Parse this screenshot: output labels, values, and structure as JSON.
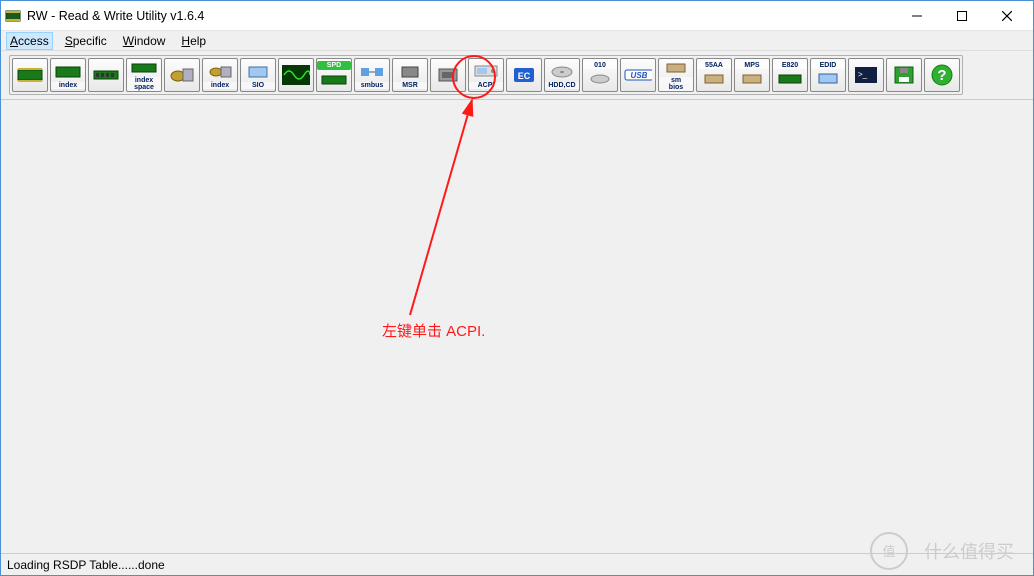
{
  "titlebar": {
    "title": "RW - Read & Write Utility v1.6.4"
  },
  "menubar": {
    "items": [
      {
        "label": "Access",
        "underline": "A",
        "selected": true
      },
      {
        "label": "Specific",
        "underline": "S",
        "selected": false
      },
      {
        "label": "Window",
        "underline": "W",
        "selected": false
      },
      {
        "label": "Help",
        "underline": "H",
        "selected": false
      }
    ]
  },
  "toolbar": {
    "buttons": [
      {
        "name": "pci-button",
        "caption": ""
      },
      {
        "name": "index-button",
        "caption": "index"
      },
      {
        "name": "memory-button",
        "caption": ""
      },
      {
        "name": "index-space-button",
        "caption": "index\nspace"
      },
      {
        "name": "io-button",
        "caption": ""
      },
      {
        "name": "io-index-button",
        "caption": "index"
      },
      {
        "name": "sio-button",
        "caption": "SIO"
      },
      {
        "name": "clock-button",
        "caption": ""
      },
      {
        "name": "spd-button",
        "caption": "SPD"
      },
      {
        "name": "smbus-button",
        "caption": "smbus"
      },
      {
        "name": "msr-button",
        "caption": "MSR"
      },
      {
        "name": "cpu-button",
        "caption": ""
      },
      {
        "name": "acpi-button",
        "caption": "ACPI"
      },
      {
        "name": "ec-button",
        "caption": "EC"
      },
      {
        "name": "hdd-cd-button",
        "caption": "HDD,CD"
      },
      {
        "name": "o10-button",
        "caption": "010"
      },
      {
        "name": "usb-button",
        "caption": "USB"
      },
      {
        "name": "smbios-button",
        "caption": "sm\nbios"
      },
      {
        "name": "aa55-button",
        "caption": "55AA"
      },
      {
        "name": "mps-button",
        "caption": "MPS"
      },
      {
        "name": "e820-button",
        "caption": "E820"
      },
      {
        "name": "edid-button",
        "caption": "EDID"
      },
      {
        "name": "cmd-button",
        "caption": ""
      },
      {
        "name": "disk-button",
        "caption": ""
      },
      {
        "name": "help-button",
        "caption": ""
      }
    ]
  },
  "statusbar": {
    "text": "Loading RSDP Table......done"
  },
  "annotation": {
    "text": "左键单击  ACPI."
  },
  "watermark": {
    "text": "什么值得买"
  }
}
